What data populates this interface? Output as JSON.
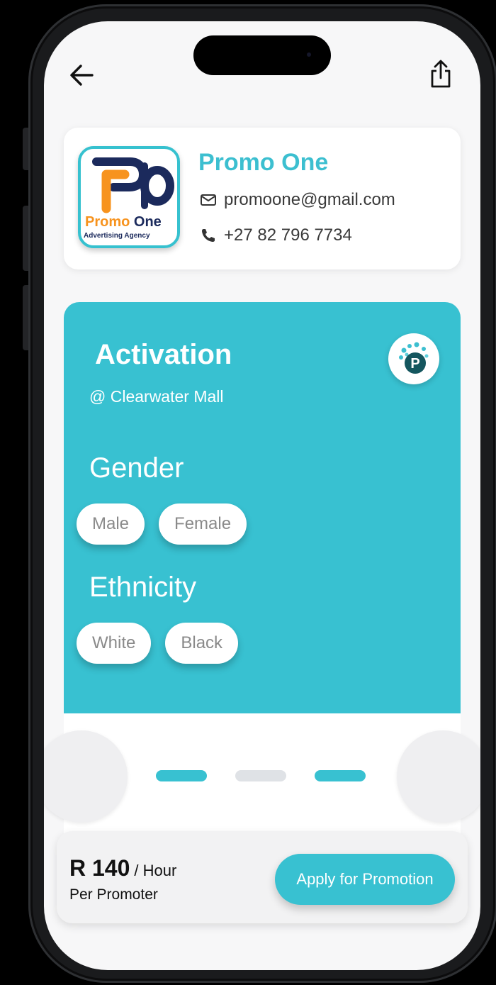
{
  "agency": {
    "name": "Promo One",
    "email": "promoone@gmail.com",
    "phone": "+27 82 796 7734",
    "logo_text_main": "Promo",
    "logo_text_main_accent": "One",
    "logo_text_sub": "Advertising Agency"
  },
  "promotion": {
    "title": "Activation",
    "location": "@ Clearwater Mall",
    "badge_letter": "P",
    "gender_heading": "Gender",
    "gender_options": [
      "Male",
      "Female"
    ],
    "ethnicity_heading": "Ethnicity",
    "ethnicity_options": [
      "White",
      "Black"
    ]
  },
  "carousel": {
    "dots": [
      "active",
      "inactive",
      "active"
    ]
  },
  "pricing": {
    "amount": "R 140",
    "unit": "/ Hour",
    "sub": "Per Promoter",
    "apply_label": "Apply for Promotion"
  },
  "colors": {
    "accent": "#38c1d1",
    "logo_navy": "#1b2a5c",
    "logo_orange": "#f7931e"
  },
  "icons": {
    "back": "arrow-left-icon",
    "share": "share-icon",
    "email": "envelope-icon",
    "phone": "phone-icon"
  }
}
